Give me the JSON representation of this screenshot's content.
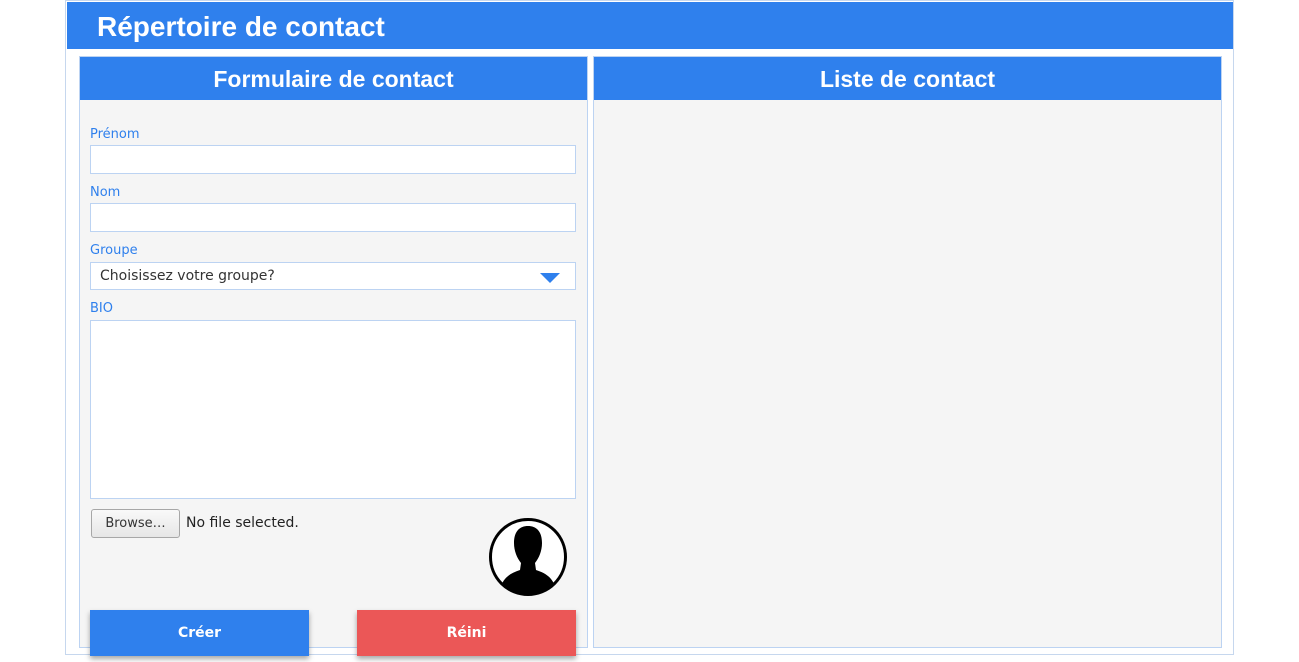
{
  "app": {
    "title": "Répertoire de contact"
  },
  "form": {
    "header": "Formulaire de contact",
    "prenom": {
      "label": "Prénom",
      "value": ""
    },
    "nom": {
      "label": "Nom",
      "value": ""
    },
    "groupe": {
      "label": "Groupe",
      "selected": "Choisissez votre groupe?"
    },
    "bio": {
      "label": "BIO",
      "value": ""
    },
    "file": {
      "browse_label": "Browse…",
      "status": "No file selected."
    },
    "avatar_icon": "user-silhouette-icon",
    "create_label": "Créer",
    "reset_label": "Réini"
  },
  "list": {
    "header": "Liste de contact",
    "contacts": []
  },
  "colors": {
    "primary": "#2f80ed",
    "danger": "#eb5757",
    "panel_bg": "#f5f5f5"
  }
}
